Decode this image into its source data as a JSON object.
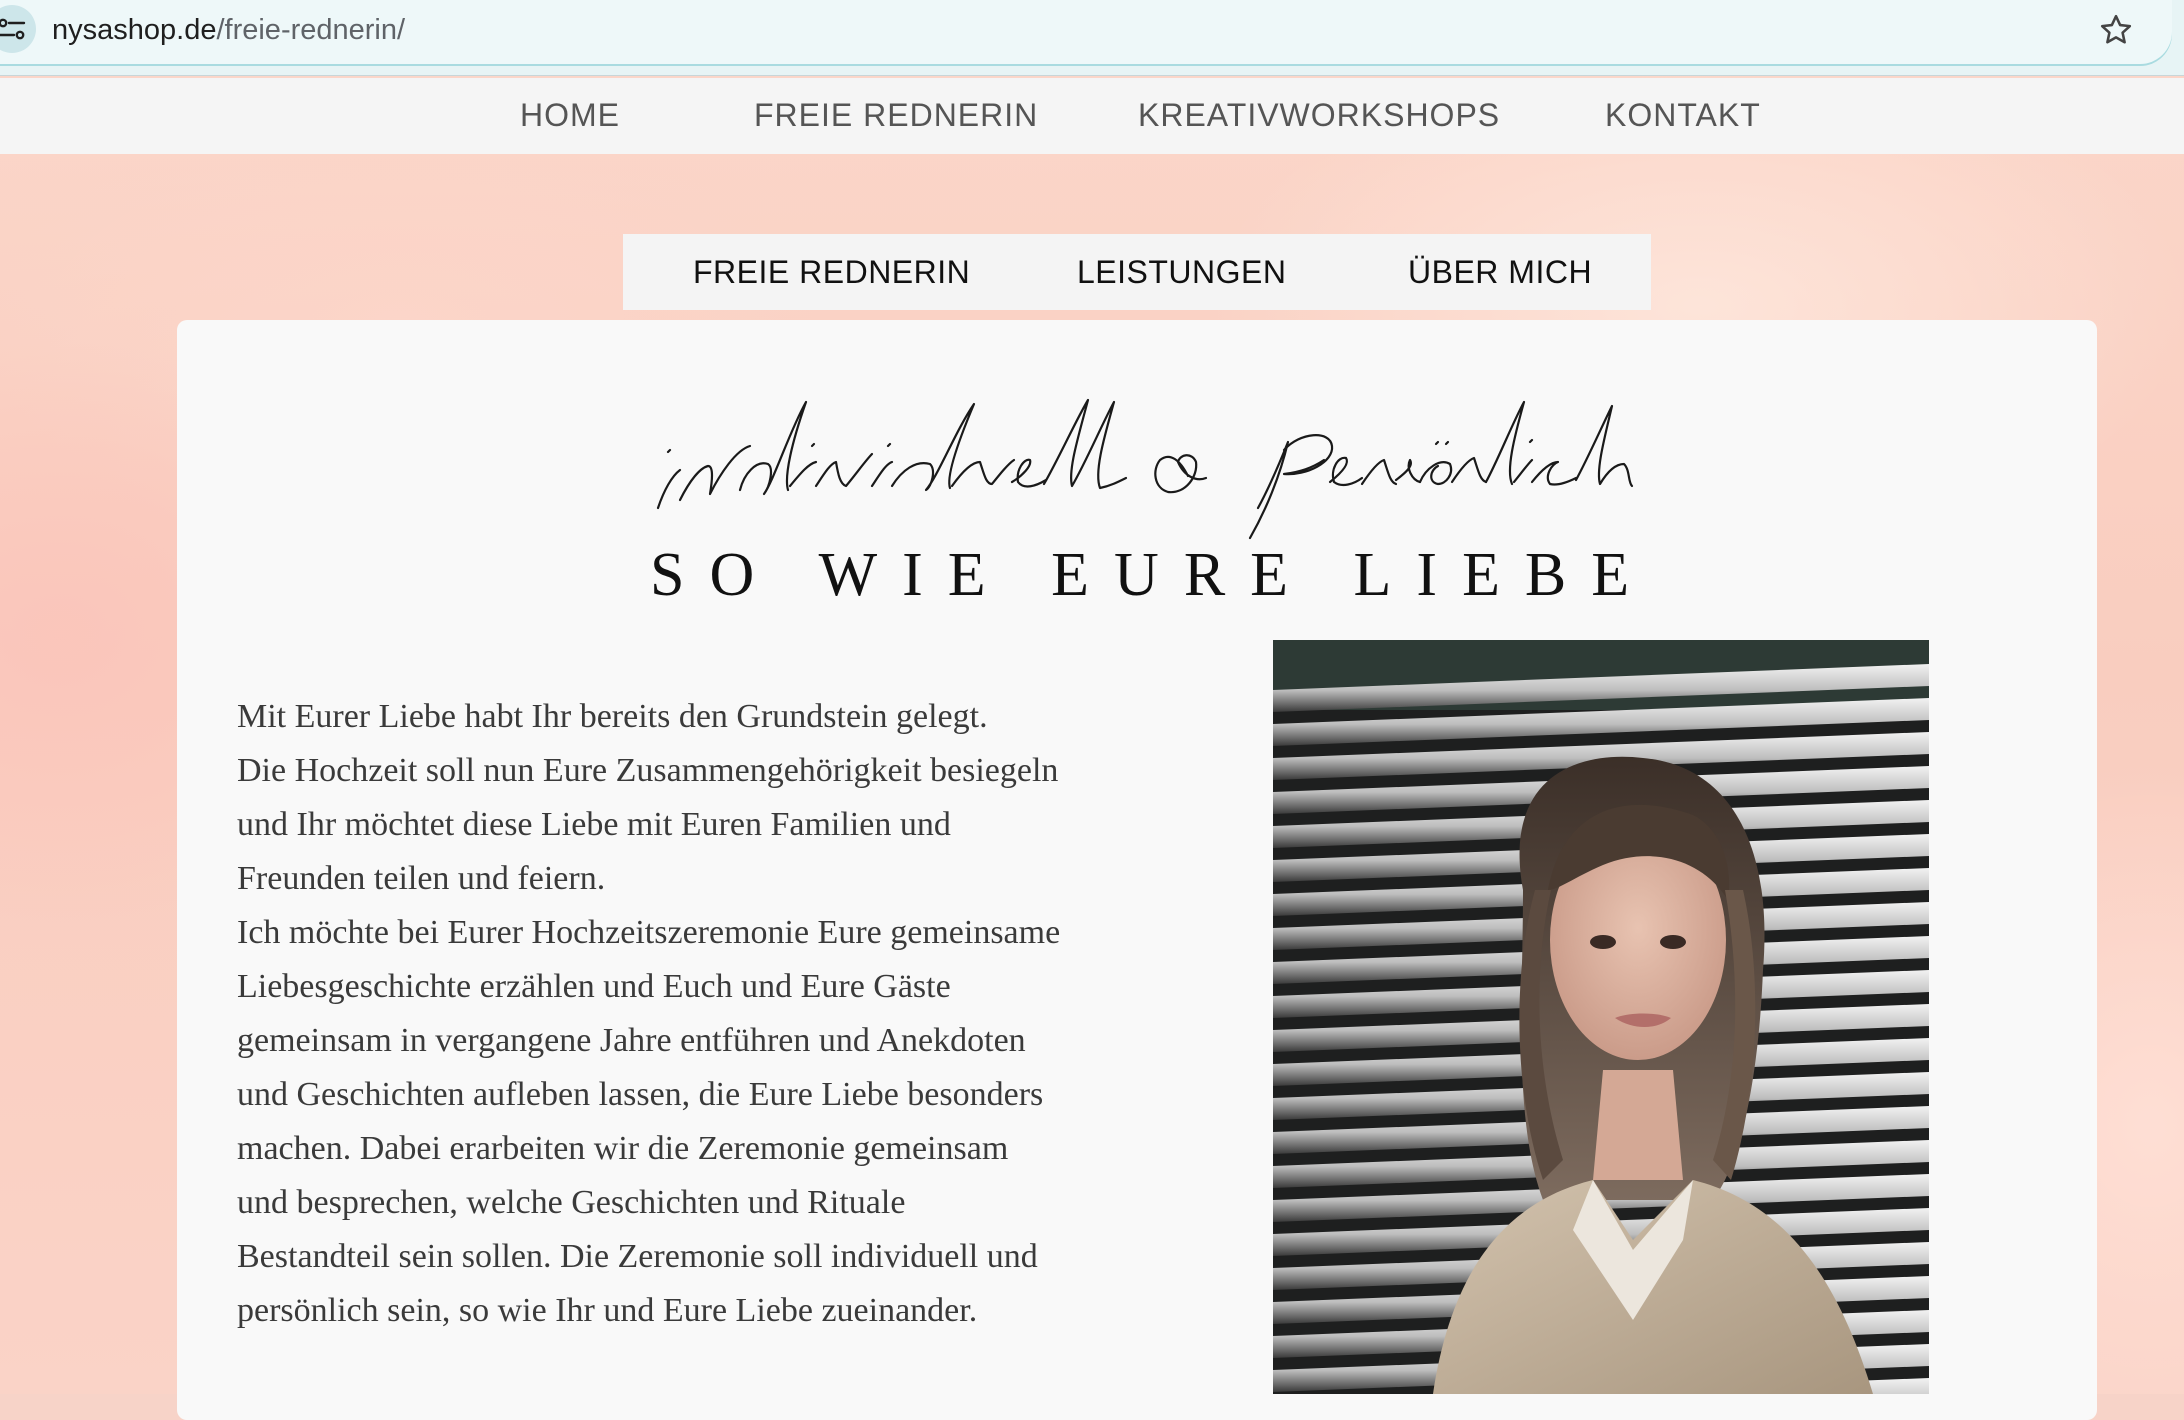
{
  "browser": {
    "url_host": "nysashop.de",
    "url_path": "/freie-rednerin/"
  },
  "main_nav": {
    "items": [
      {
        "label": "HOME"
      },
      {
        "label": "FREIE REDNERIN"
      },
      {
        "label": "KREATIVWORKSHOPS"
      },
      {
        "label": "KONTAKT"
      }
    ]
  },
  "sub_nav": {
    "items": [
      {
        "label": "FREIE REDNERIN"
      },
      {
        "label": "LEISTUNGEN"
      },
      {
        "label": "ÜBER MICH"
      }
    ]
  },
  "content": {
    "script_heading": "individuell & persönlich",
    "headline": "SO WIE EURE LIEBE",
    "lines": [
      "Mit Eurer Liebe habt Ihr bereits den Grundstein gelegt.",
      "Die Hochzeit soll nun Eure Zusammengehörigkeit besiegeln",
      "und Ihr möchtet diese Liebe mit Euren Familien und",
      "Freunden teilen und feiern.",
      "Ich möchte bei Eurer Hochzeitszeremonie Eure gemeinsame",
      "Liebesgeschichte erzählen und Euch und Eure Gäste",
      "gemeinsam in vergangene Jahre entführen und Anekdoten",
      "und Geschichten aufleben lassen, die Eure Liebe besonders",
      "machen. Dabei erarbeiten wir die Zeremonie gemeinsam",
      "und besprechen, welche Geschichten und Rituale",
      "Bestandteil sein sollen. Die Zeremonie soll individuell und",
      "persönlich sein, so wie Ihr und Eure Liebe zueinander."
    ]
  },
  "icons": {
    "site_info": "tune-icon",
    "bookmark": "star-icon"
  }
}
